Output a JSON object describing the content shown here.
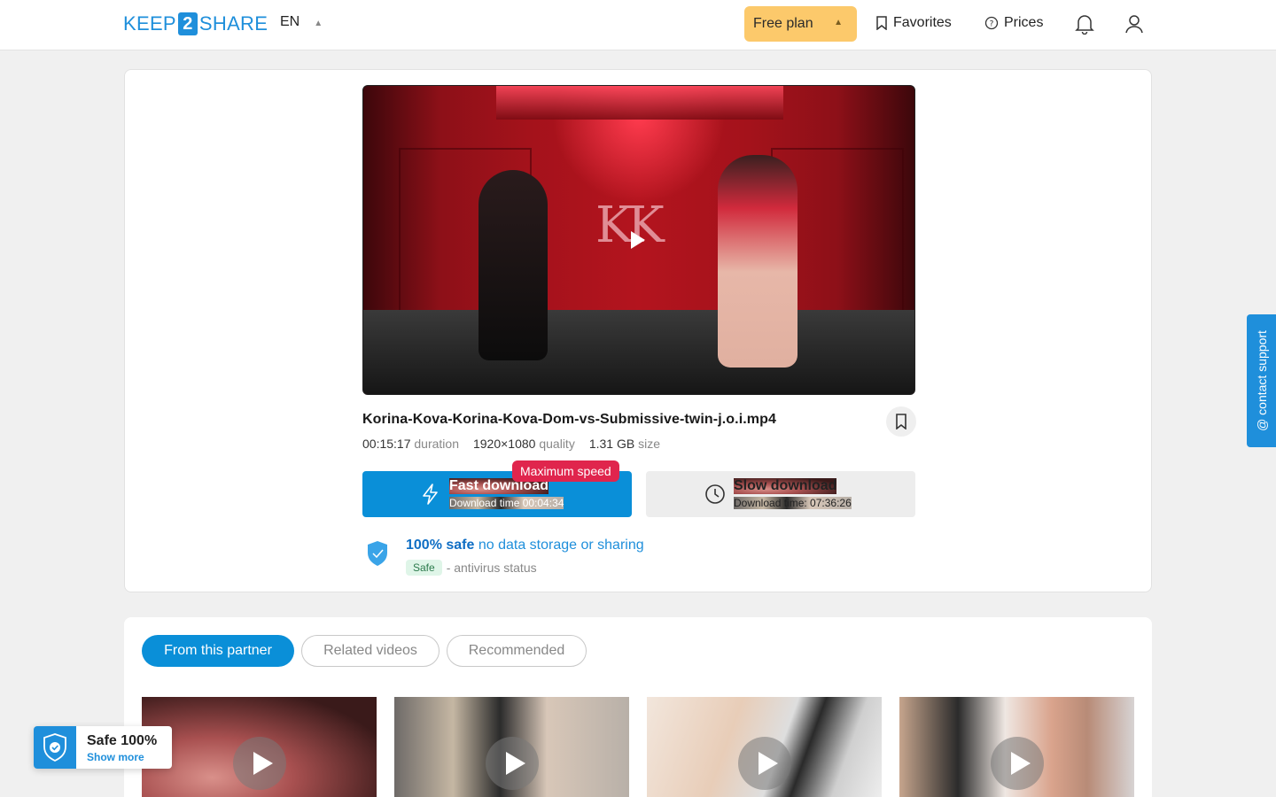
{
  "header": {
    "logo_left": "KEEP",
    "logo_mid": "2",
    "logo_right": "SHARE",
    "lang": "EN",
    "plan": "Free plan",
    "favorites": "Favorites",
    "prices": "Prices"
  },
  "file": {
    "name": "Korina-Kova-Korina-Kova-Dom-vs-Submissive-twin-j.o.i.mp4",
    "duration_value": "00:15:17",
    "duration_label": "duration",
    "quality_value": "1920×1080",
    "quality_label": "quality",
    "size_value": "1.31 GB",
    "size_label": "size"
  },
  "download": {
    "badge": "Maximum speed",
    "fast_title": "Fast download",
    "fast_time": "Download time 00:04:34",
    "slow_title": "Slow download",
    "slow_time": "Download time: 07:36:26"
  },
  "safety": {
    "strong": "100% safe",
    "rest": "no data storage or sharing",
    "pill": "Safe",
    "av": "- antivirus status"
  },
  "tabs": [
    "From this partner",
    "Related videos",
    "Recommended"
  ],
  "widget": {
    "title": "Safe 100%",
    "more": "Show more"
  },
  "contact": "@ contact support",
  "colors": {
    "accent": "#0a8fd8",
    "plan": "#fcc96b",
    "badge": "#e0254d"
  }
}
